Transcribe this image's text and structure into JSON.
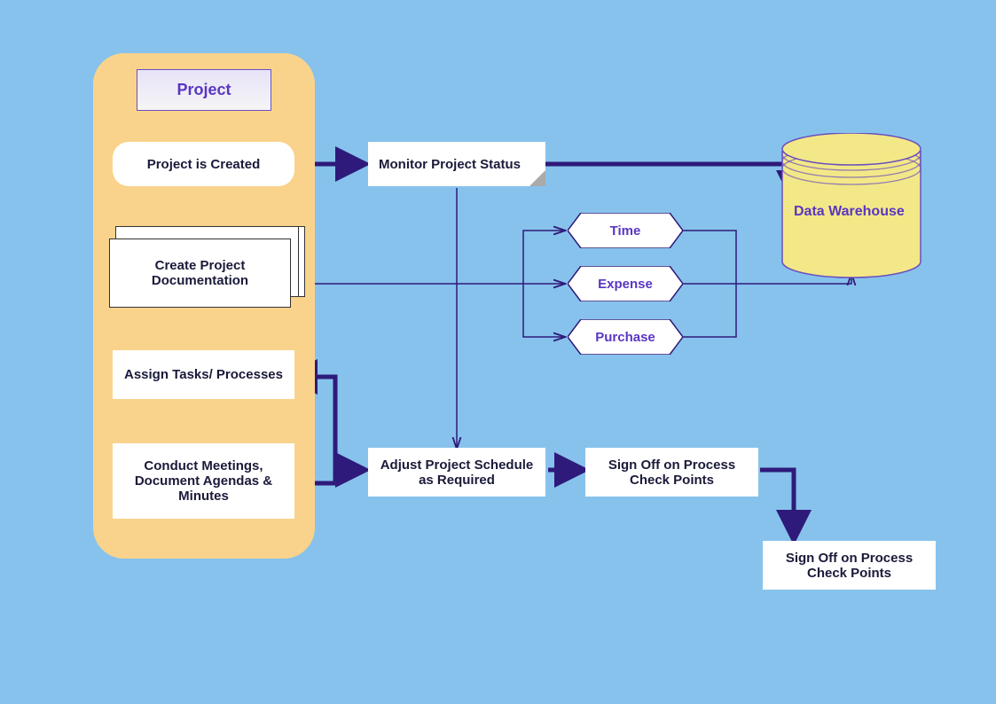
{
  "sidebar": {
    "title": "Project",
    "items": {
      "created": "Project is Created",
      "docs": "Create Project Documentation",
      "tasks": "Assign Tasks/ Processes",
      "meetings": "Conduct Meetings, Document Agendas & Minutes"
    }
  },
  "main": {
    "monitor": "Monitor Project Status",
    "adjust": "Adjust Project Schedule as Required",
    "signoff1": "Sign Off on Process Check Points",
    "signoff2": "Sign Off on Process Check Points"
  },
  "hex": {
    "time": "Time",
    "expense": "Expense",
    "purchase": "Purchase"
  },
  "db": {
    "label": "Data Warehouse"
  },
  "colors": {
    "bg": "#87c2ec",
    "sidebar": "#f9d38c",
    "purple": "#2e1a7a",
    "violet": "#5a36c2",
    "cylinder": "#f3e887"
  }
}
